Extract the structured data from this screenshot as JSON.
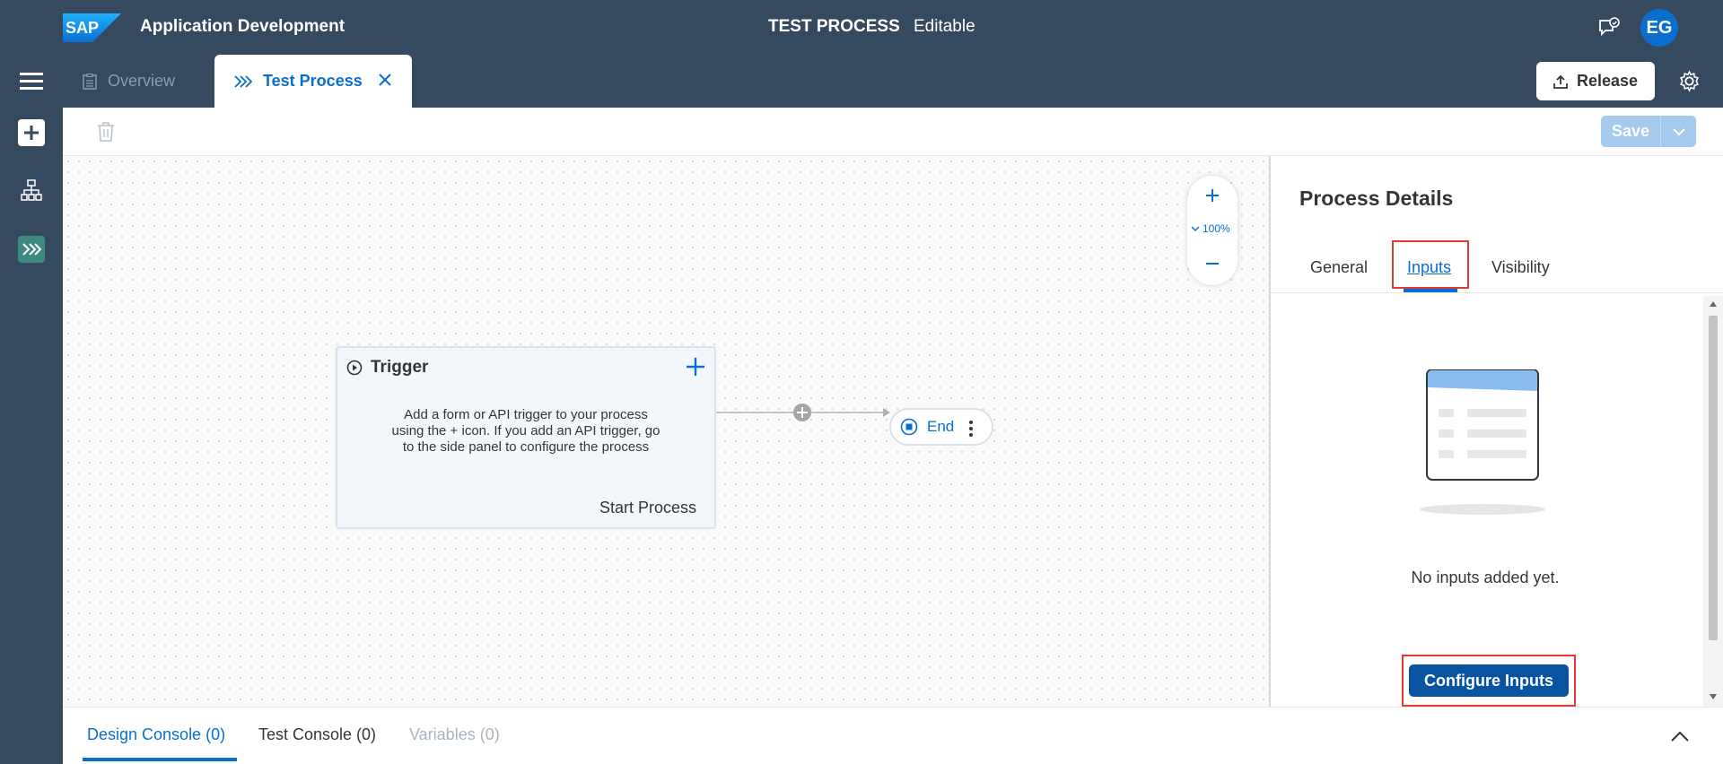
{
  "shell": {
    "logo_text": "SAP",
    "app_title": "Application Development",
    "process_title": "TEST PROCESS",
    "process_state": "Editable",
    "avatar_initials": "EG"
  },
  "tabs": {
    "overview_label": "Overview",
    "test_process_label": "Test Process",
    "release_label": "Release"
  },
  "toolbar": {
    "save_label": "Save"
  },
  "canvas": {
    "zoom_level": "100%",
    "trigger": {
      "title": "Trigger",
      "description": "Add a form or API trigger to your process using the + icon. If you add an API trigger, go to the side panel to configure the process",
      "start_label": "Start Process"
    },
    "end_label": "End"
  },
  "panel": {
    "title": "Process Details",
    "tabs": [
      "General",
      "Inputs",
      "Visibility"
    ],
    "active_tab": "Inputs",
    "empty_message": "No inputs added yet.",
    "configure_label": "Configure Inputs"
  },
  "console": {
    "tabs": [
      "Design Console (0)",
      "Test Console (0)",
      "Variables (0)"
    ]
  },
  "colors": {
    "shell": "#354a5f",
    "accent": "#0a6ed1",
    "primary_button": "#0854a0",
    "highlight": "#e03a3a",
    "save_disabled": "#a6c9ee"
  },
  "icons": [
    "sap-logo",
    "feedback-icon",
    "menu-icon",
    "overview-icon",
    "process-icon",
    "close-icon",
    "upload-icon",
    "gear-icon",
    "add-icon",
    "hierarchy-icon",
    "trash-icon",
    "chevron-down-icon",
    "zoom-in-icon",
    "zoom-out-icon",
    "play-icon",
    "stop-icon",
    "more-icon",
    "chevron-up-icon"
  ]
}
